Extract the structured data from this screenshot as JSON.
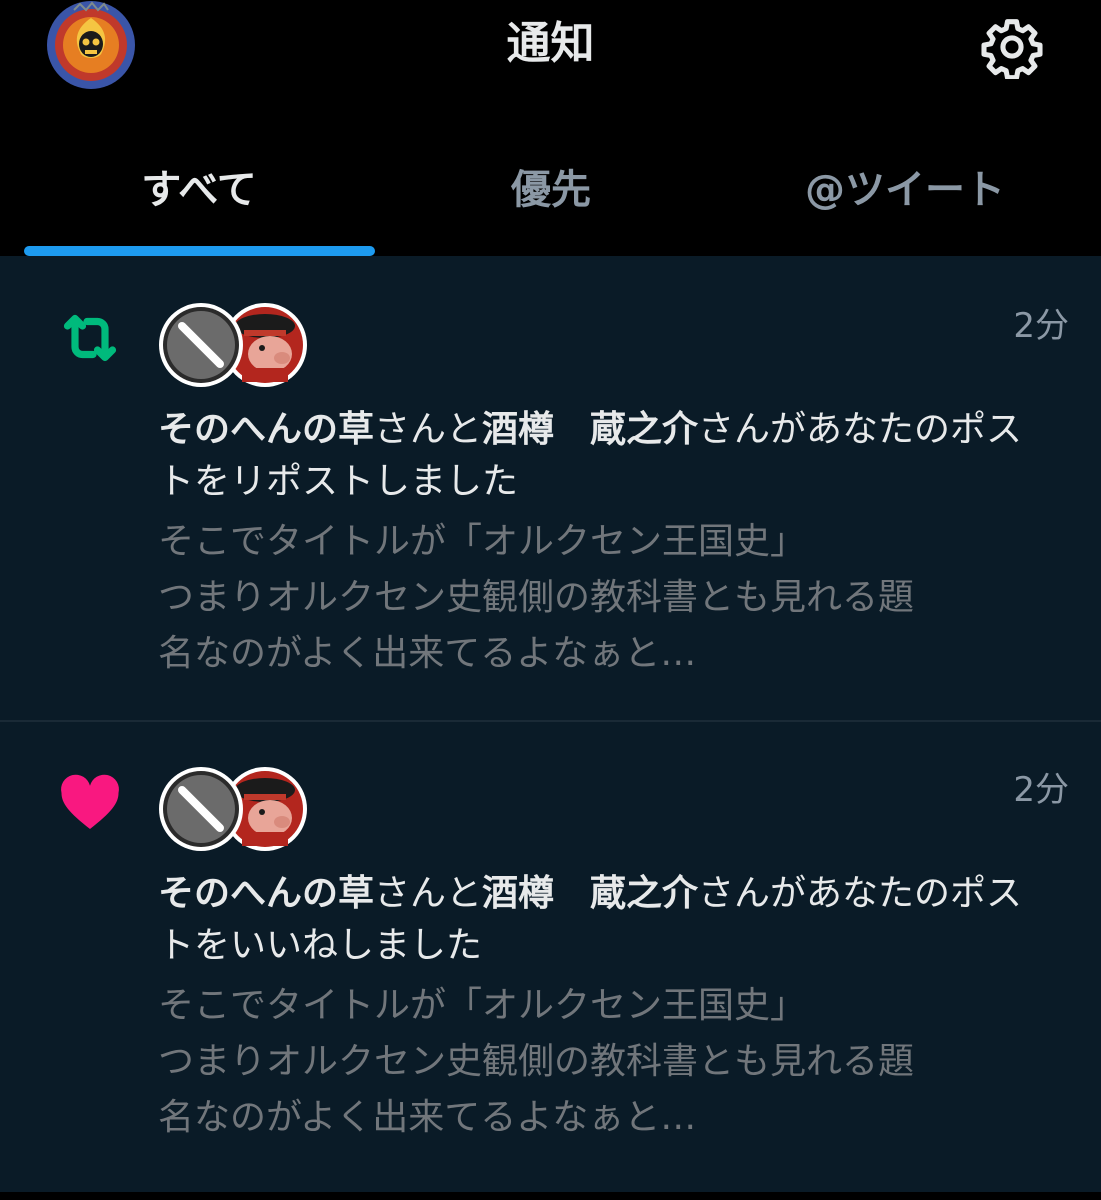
{
  "header": {
    "title": "通知",
    "profile_icon": "skull-flame-avatar",
    "settings_icon": "gear-icon"
  },
  "tabs": [
    {
      "label": "すべて",
      "active": true
    },
    {
      "label": "優先",
      "active": false
    },
    {
      "label": "@ツイート",
      "active": false
    }
  ],
  "colors": {
    "accent": "#1d9bf0",
    "repost_green": "#00ba7c",
    "like_pink": "#f91880",
    "background": "#0a1b27"
  },
  "notifications": [
    {
      "type": "repost",
      "icon": "repost-icon",
      "time": "2分",
      "user1": "そのへんの草",
      "sep1": "さんと",
      "user2": "酒樽　蔵之介",
      "action": "さんがあなたのポストをリポストしました",
      "snippet_lines": [
        "そこでタイトルが「オルクセン王国史」",
        "つまりオルクセン史観側の教科書とも見れる題",
        "名なのがよく出来てるよなぁと…"
      ]
    },
    {
      "type": "like",
      "icon": "heart-icon",
      "time": "2分",
      "user1": "そのへんの草",
      "sep1": "さんと",
      "user2": "酒樽　蔵之介",
      "action": "さんがあなたのポストをいいねしました",
      "snippet_lines": [
        "そこでタイトルが「オルクセン王国史」",
        "つまりオルクセン史観側の教科書とも見れる題",
        "名なのがよく出来てるよなぁと…"
      ]
    }
  ]
}
